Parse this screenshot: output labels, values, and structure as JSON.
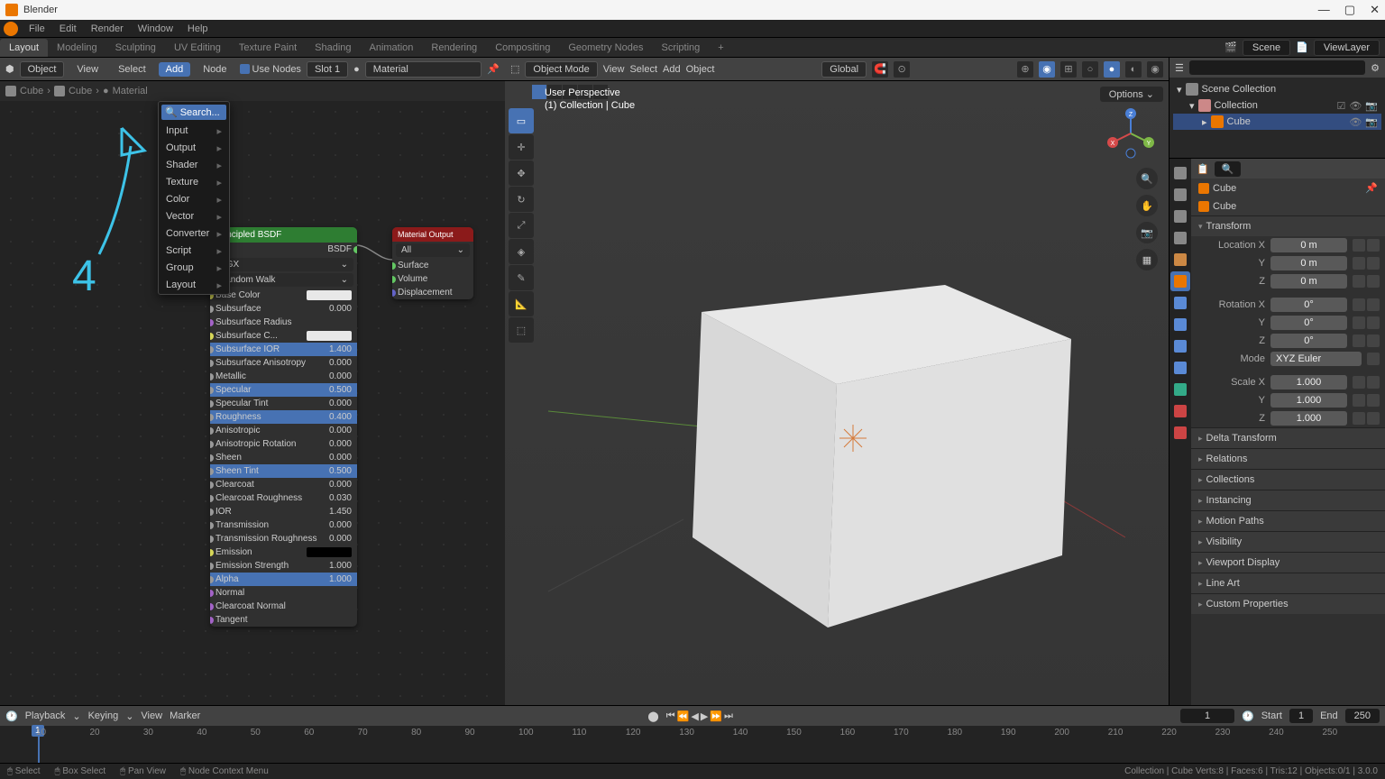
{
  "app": {
    "title": "Blender"
  },
  "mainmenu": [
    "File",
    "Edit",
    "Render",
    "Window",
    "Help"
  ],
  "workspaces": {
    "tabs": [
      "Layout",
      "Modeling",
      "Sculpting",
      "UV Editing",
      "Texture Paint",
      "Shading",
      "Animation",
      "Rendering",
      "Compositing",
      "Geometry Nodes",
      "Scripting"
    ],
    "active": 0,
    "scene": "Scene",
    "viewlayer": "ViewLayer"
  },
  "nodeeditor": {
    "mode": "Object",
    "menus": [
      "View",
      "Select",
      "Add",
      "Node"
    ],
    "use_nodes": "Use Nodes",
    "slot": "Slot 1",
    "material": "Material",
    "breadcrumb": [
      "Cube",
      "Cube",
      "Material"
    ],
    "addmenu": {
      "search": "Search...",
      "items": [
        "Input",
        "Output",
        "Shader",
        "Texture",
        "Color",
        "Vector",
        "Converter",
        "Script",
        "Group",
        "Layout"
      ]
    },
    "bsdf": {
      "title": "Principled BSDF",
      "bsdf_out": "BSDF",
      "dd1": "GGX",
      "dd2": "Random Walk",
      "rows": [
        {
          "label": "Base Color",
          "type": "swatch"
        },
        {
          "label": "Subsurface",
          "val": "0.000"
        },
        {
          "label": "Subsurface Radius"
        },
        {
          "label": "Subsurface C...",
          "type": "swatch"
        },
        {
          "label": "Subsurface IOR",
          "val": "1.400",
          "sel": true
        },
        {
          "label": "Subsurface Anisotropy",
          "val": "0.000"
        },
        {
          "label": "Metallic",
          "val": "0.000"
        },
        {
          "label": "Specular",
          "val": "0.500",
          "sel": true
        },
        {
          "label": "Specular Tint",
          "val": "0.000"
        },
        {
          "label": "Roughness",
          "val": "0.400",
          "sel": true
        },
        {
          "label": "Anisotropic",
          "val": "0.000"
        },
        {
          "label": "Anisotropic Rotation",
          "val": "0.000"
        },
        {
          "label": "Sheen",
          "val": "0.000"
        },
        {
          "label": "Sheen Tint",
          "val": "0.500",
          "sel": true
        },
        {
          "label": "Clearcoat",
          "val": "0.000"
        },
        {
          "label": "Clearcoat Roughness",
          "val": "0.030"
        },
        {
          "label": "IOR",
          "val": "1.450"
        },
        {
          "label": "Transmission",
          "val": "0.000"
        },
        {
          "label": "Transmission Roughness",
          "val": "0.000"
        },
        {
          "label": "Emission",
          "type": "swatch_blk"
        },
        {
          "label": "Emission Strength",
          "val": "1.000"
        },
        {
          "label": "Alpha",
          "val": "1.000",
          "sel": true
        },
        {
          "label": "Normal"
        },
        {
          "label": "Clearcoat Normal"
        },
        {
          "label": "Tangent"
        }
      ]
    },
    "mout": {
      "title": "Material Output",
      "all": "All",
      "inputs": [
        "Surface",
        "Volume",
        "Displacement"
      ]
    }
  },
  "viewport": {
    "mode": "Object Mode",
    "menus": [
      "View",
      "Select",
      "Add",
      "Object"
    ],
    "orient": "Global",
    "info1": "User Perspective",
    "info2": "(1) Collection | Cube",
    "options": "Options"
  },
  "outliner": {
    "root": "Scene Collection",
    "coll": "Collection",
    "cube": "Cube"
  },
  "properties": {
    "object": "Cube",
    "bread": "Cube",
    "transform": {
      "title": "Transform",
      "loc": {
        "label": "Location X",
        "x": "0 m",
        "y": "0 m",
        "z": "0 m"
      },
      "rot": {
        "label": "Rotation X",
        "x": "0°",
        "y": "0°",
        "z": "0°"
      },
      "mode": {
        "label": "Mode",
        "val": "XYZ Euler"
      },
      "scale": {
        "label": "Scale X",
        "x": "1.000",
        "y": "1.000",
        "z": "1.000"
      }
    },
    "panels": [
      "Delta Transform",
      "Relations",
      "Collections",
      "Instancing",
      "Motion Paths",
      "Visibility",
      "Viewport Display",
      "Line Art",
      "Custom Properties"
    ]
  },
  "timeline": {
    "menus": [
      "Playback",
      "Keying",
      "View",
      "Marker"
    ],
    "current": "1",
    "start_lbl": "Start",
    "start": "1",
    "end_lbl": "End",
    "end": "250",
    "ticks": [
      "10",
      "20",
      "30",
      "40",
      "50",
      "60",
      "70",
      "80",
      "90",
      "100",
      "110",
      "120",
      "130",
      "140",
      "150",
      "160",
      "170",
      "180",
      "190",
      "200",
      "210",
      "220",
      "230",
      "240",
      "250"
    ]
  },
  "statusbar": {
    "items": [
      "Select",
      "Box Select",
      "Pan View",
      "Node Context Menu"
    ],
    "right": "Collection | Cube   Verts:8 | Faces:6 | Tris:12 | Objects:0/1 | 3.0.0"
  }
}
